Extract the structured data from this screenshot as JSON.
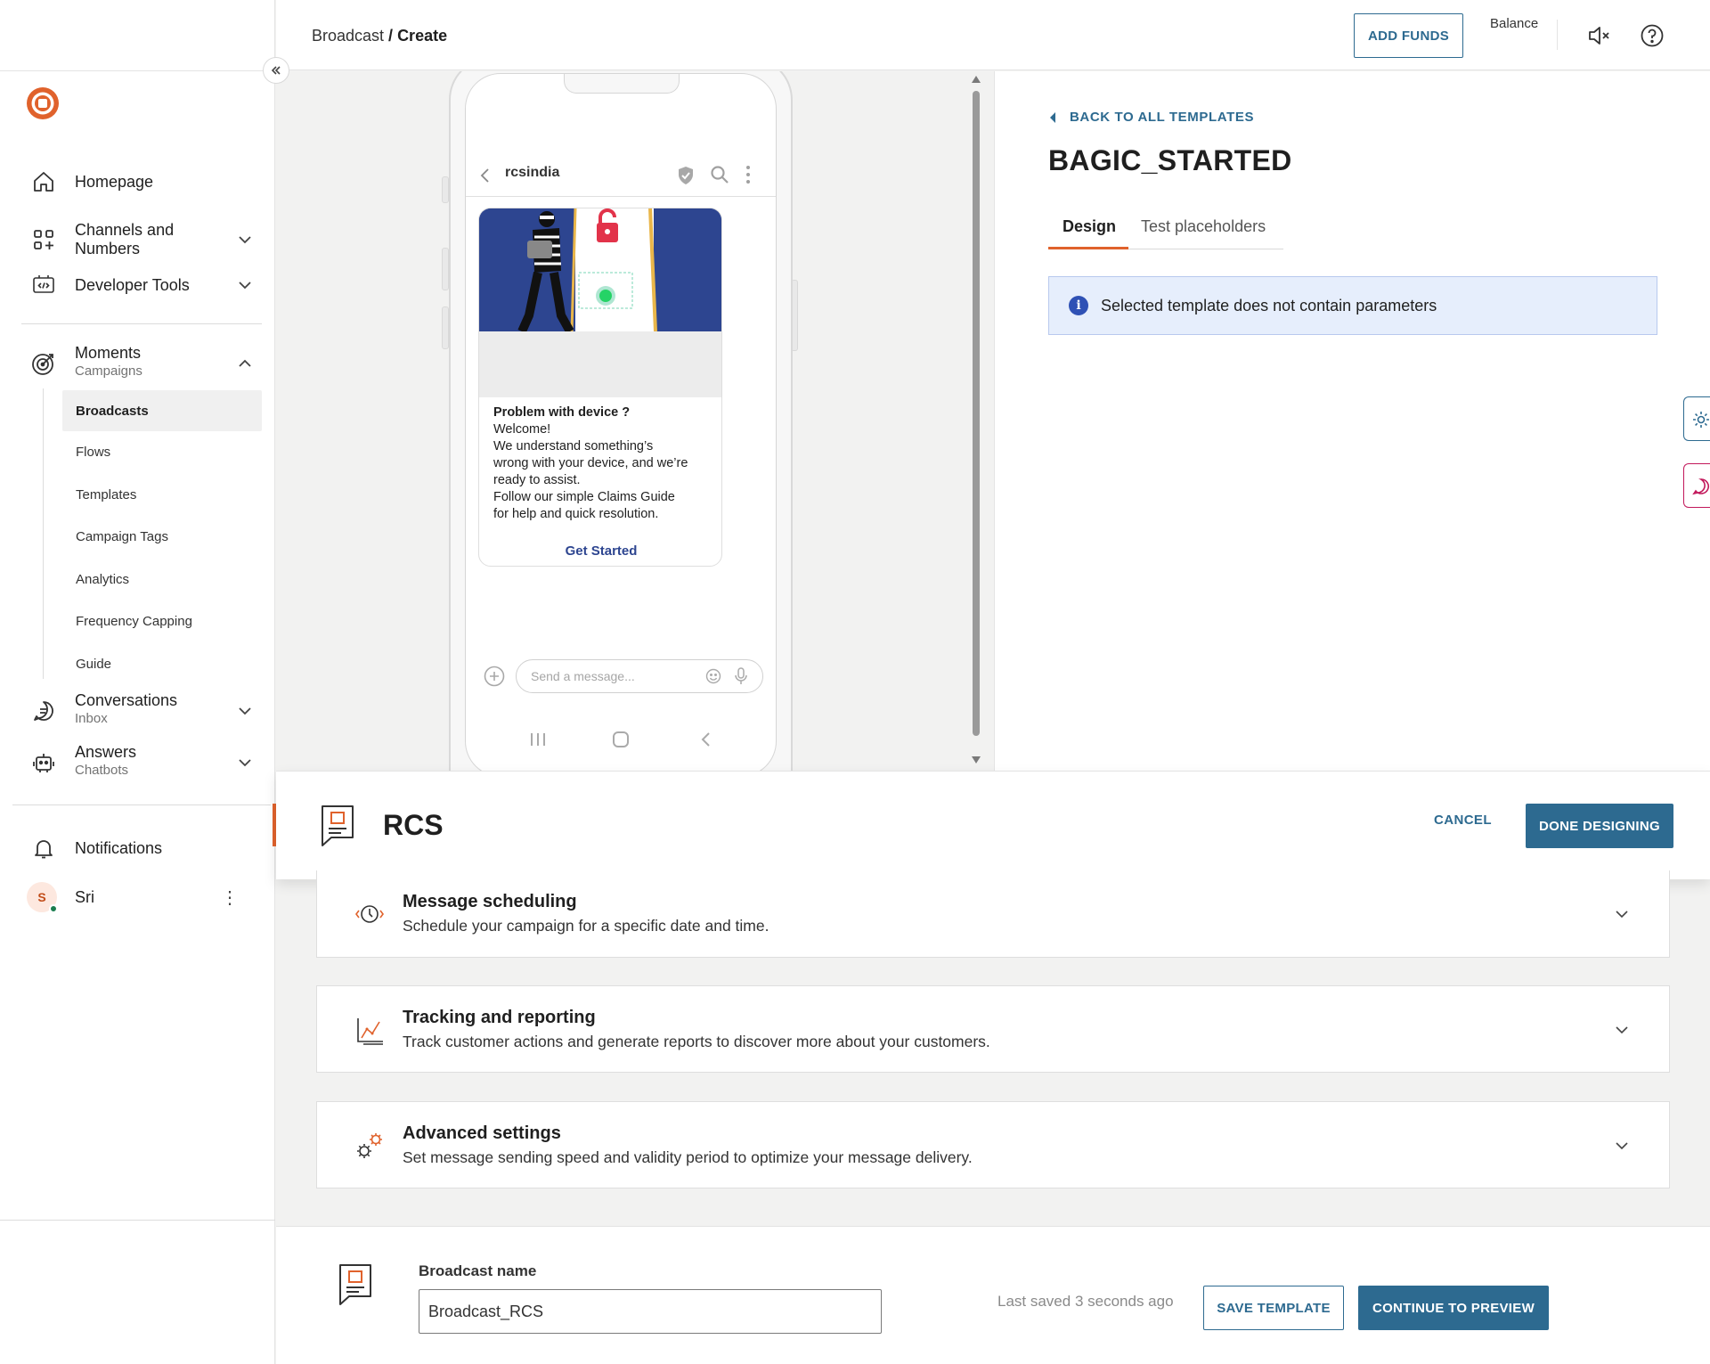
{
  "header": {
    "breadcrumb_parent": "Broadcast",
    "breadcrumb_separator": " / ",
    "breadcrumb_current": "Create",
    "add_funds_label": "ADD FUNDS",
    "balance_label": "Balance",
    "sound_icon": "speaker-muted-icon",
    "help_icon": "help-circle-icon"
  },
  "sidebar": {
    "collapse_icon": "double-chevron-left-icon",
    "items": [
      {
        "label": "Homepage",
        "icon": "home-icon"
      },
      {
        "label": "Channels and Numbers",
        "icon": "grid-plus-icon"
      },
      {
        "label": "Developer Tools",
        "icon": "code-window-icon"
      },
      {
        "label": "Moments",
        "sub": "Campaigns",
        "icon": "target-icon"
      },
      {
        "label": "Conversations",
        "sub": "Inbox",
        "icon": "chat-icon"
      },
      {
        "label": "Answers",
        "sub": "Chatbots",
        "icon": "robot-icon"
      },
      {
        "label": "Notifications",
        "icon": "bell-icon"
      }
    ],
    "moments_subitems": [
      "Broadcasts",
      "Flows",
      "Templates",
      "Campaign Tags",
      "Analytics",
      "Frequency Capping",
      "Guide"
    ],
    "active_subitem": "Broadcasts",
    "user": {
      "initial": "S",
      "name": "Sri"
    }
  },
  "preview": {
    "sender_name": "rcsindia",
    "card_title": "Problem with device ?",
    "card_body_lines": [
      "Welcome!",
      "We understand something’s",
      "wrong with your device, and we’re",
      "ready to assist.",
      "Follow our simple Claims Guide",
      "for help and quick resolution."
    ],
    "card_cta": "Get Started",
    "compose_placeholder": "Send a message..."
  },
  "template": {
    "back_label": "BACK TO ALL TEMPLATES",
    "name": "BAGIC_STARTED",
    "tabs": [
      {
        "label": "Design",
        "active": true
      },
      {
        "label": "Test placeholders",
        "active": false
      }
    ],
    "info_message": "Selected template does not contain parameters"
  },
  "channel_bar": {
    "channel": "RCS",
    "cancel_label": "CANCEL",
    "done_label": "DONE DESIGNING"
  },
  "sections": [
    {
      "title": "Message scheduling",
      "desc": "Schedule your campaign for a specific date and time.",
      "icon": "clock-arrows-icon"
    },
    {
      "title": "Tracking and reporting",
      "desc": "Track customer actions and generate reports to discover more about your customers.",
      "icon": "line-chart-icon"
    },
    {
      "title": "Advanced settings",
      "desc": "Set message sending speed and validity period to optimize your message delivery.",
      "icon": "gears-icon"
    }
  ],
  "footer": {
    "name_label": "Broadcast name",
    "name_value": "Broadcast_RCS",
    "last_saved": "Last saved 3 seconds ago",
    "save_label": "SAVE TEMPLATE",
    "continue_label": "CONTINUE TO PREVIEW"
  },
  "colors": {
    "accent": "#2d6a90",
    "brand_orange": "#e0622c",
    "info_bg": "#e6eefc",
    "rcs_card_blue": "#2d4590"
  }
}
